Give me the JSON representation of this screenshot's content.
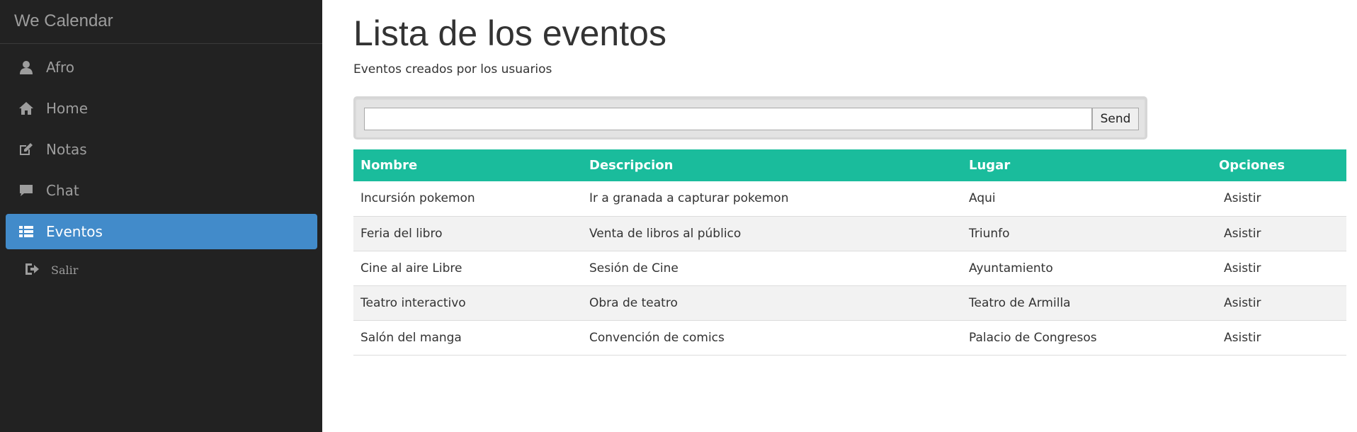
{
  "app": {
    "brand": "We Calendar"
  },
  "sidebar": {
    "items": [
      {
        "label": "Afro",
        "icon": "user-icon"
      },
      {
        "label": "Home",
        "icon": "home-icon"
      },
      {
        "label": "Notas",
        "icon": "edit-icon"
      },
      {
        "label": "Chat",
        "icon": "comment-icon"
      },
      {
        "label": "Eventos",
        "icon": "list-icon",
        "active": true
      },
      {
        "label": "Salir",
        "icon": "logout-icon"
      }
    ]
  },
  "main": {
    "title": "Lista de los eventos",
    "subtitle": "Eventos creados por los usuarios",
    "search": {
      "value": "",
      "placeholder": "",
      "button": "Send"
    },
    "table": {
      "headers": [
        "Nombre",
        "Descripcion",
        "Lugar",
        "Opciones"
      ],
      "rows": [
        {
          "nombre": "Incursión pokemon",
          "descripcion": "Ir a granada a capturar pokemon",
          "lugar": "Aqui",
          "opcion": "Asistir"
        },
        {
          "nombre": "Feria del libro",
          "descripcion": "Venta de libros al público",
          "lugar": "Triunfo",
          "opcion": "Asistir"
        },
        {
          "nombre": "Cine al aire Libre",
          "descripcion": "Sesión de Cine",
          "lugar": "Ayuntamiento",
          "opcion": "Asistir"
        },
        {
          "nombre": "Teatro interactivo",
          "descripcion": "Obra de teatro",
          "lugar": "Teatro de Armilla",
          "opcion": "Asistir"
        },
        {
          "nombre": "Salón del manga",
          "descripcion": "Convención de comics",
          "lugar": "Palacio de Congresos",
          "opcion": "Asistir"
        }
      ]
    }
  },
  "colors": {
    "sidebar_bg": "#222222",
    "active": "#428bca",
    "table_header": "#1abc9c"
  }
}
